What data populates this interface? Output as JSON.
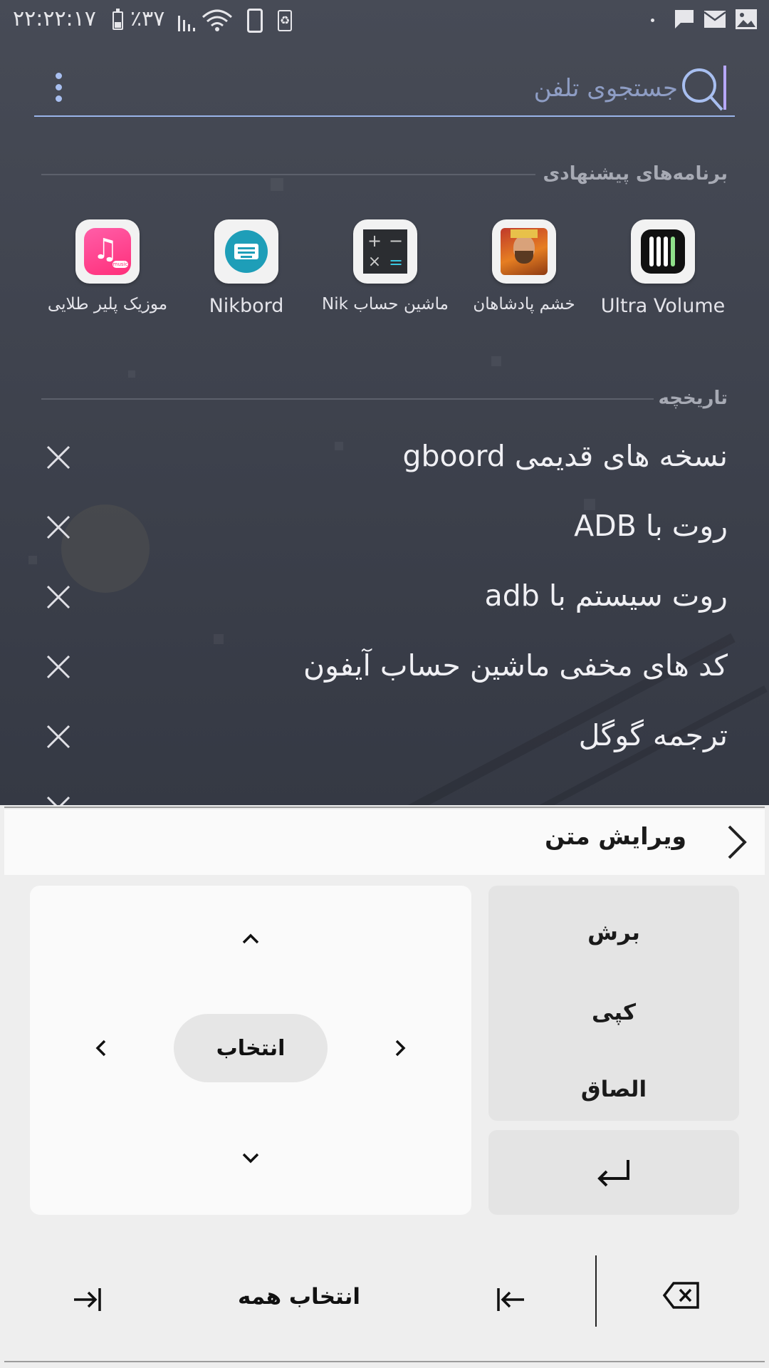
{
  "status_bar": {
    "time": "۲۲:۲۲:۱۷",
    "battery": "٪۳۷",
    "icons": [
      "battery-icon",
      "signal-icon",
      "wifi-icon",
      "phone-icon",
      "recycle-icon",
      "chat-icon",
      "mail-icon",
      "image-icon"
    ]
  },
  "search": {
    "placeholder": "جستجوی تلفن",
    "value": "",
    "icon": "search-icon",
    "menu_icon": "more-vertical-icon"
  },
  "suggested_apps": {
    "header": "برنامه‌های پیشنهادی",
    "items": [
      {
        "name": "Ultra Volume",
        "icon": "equalizer-icon"
      },
      {
        "name": "خشم پادشاهان",
        "icon": "game-icon"
      },
      {
        "name": "ماشین حساب Nik",
        "icon": "calculator-icon"
      },
      {
        "name": "Nikbord",
        "icon": "keyboard-icon"
      },
      {
        "name": "موزیک پلیر طلایی",
        "icon": "music-icon",
        "badge": "music"
      }
    ]
  },
  "history": {
    "header": "تاریخچه",
    "items": [
      "نسخه های قدیمی gboord",
      "روت با ADB",
      "روت سیستم با adb",
      "کد های مخفی ماشین حساب آیفون",
      "ترجمه گوگل"
    ]
  },
  "keyboard": {
    "title": "ویرایش متن",
    "select_label": "انتخاب",
    "cut_label": "برش",
    "copy_label": "کپی",
    "paste_label": "الصاق",
    "select_all_label": "انتخاب همه"
  },
  "colors": {
    "accent": "#9ab4ea",
    "background_dark": "#3f434e",
    "keyboard_bg": "#eeeeee",
    "music_pink": "#ff3d8b",
    "keyboard_teal": "#1e9eb8"
  }
}
